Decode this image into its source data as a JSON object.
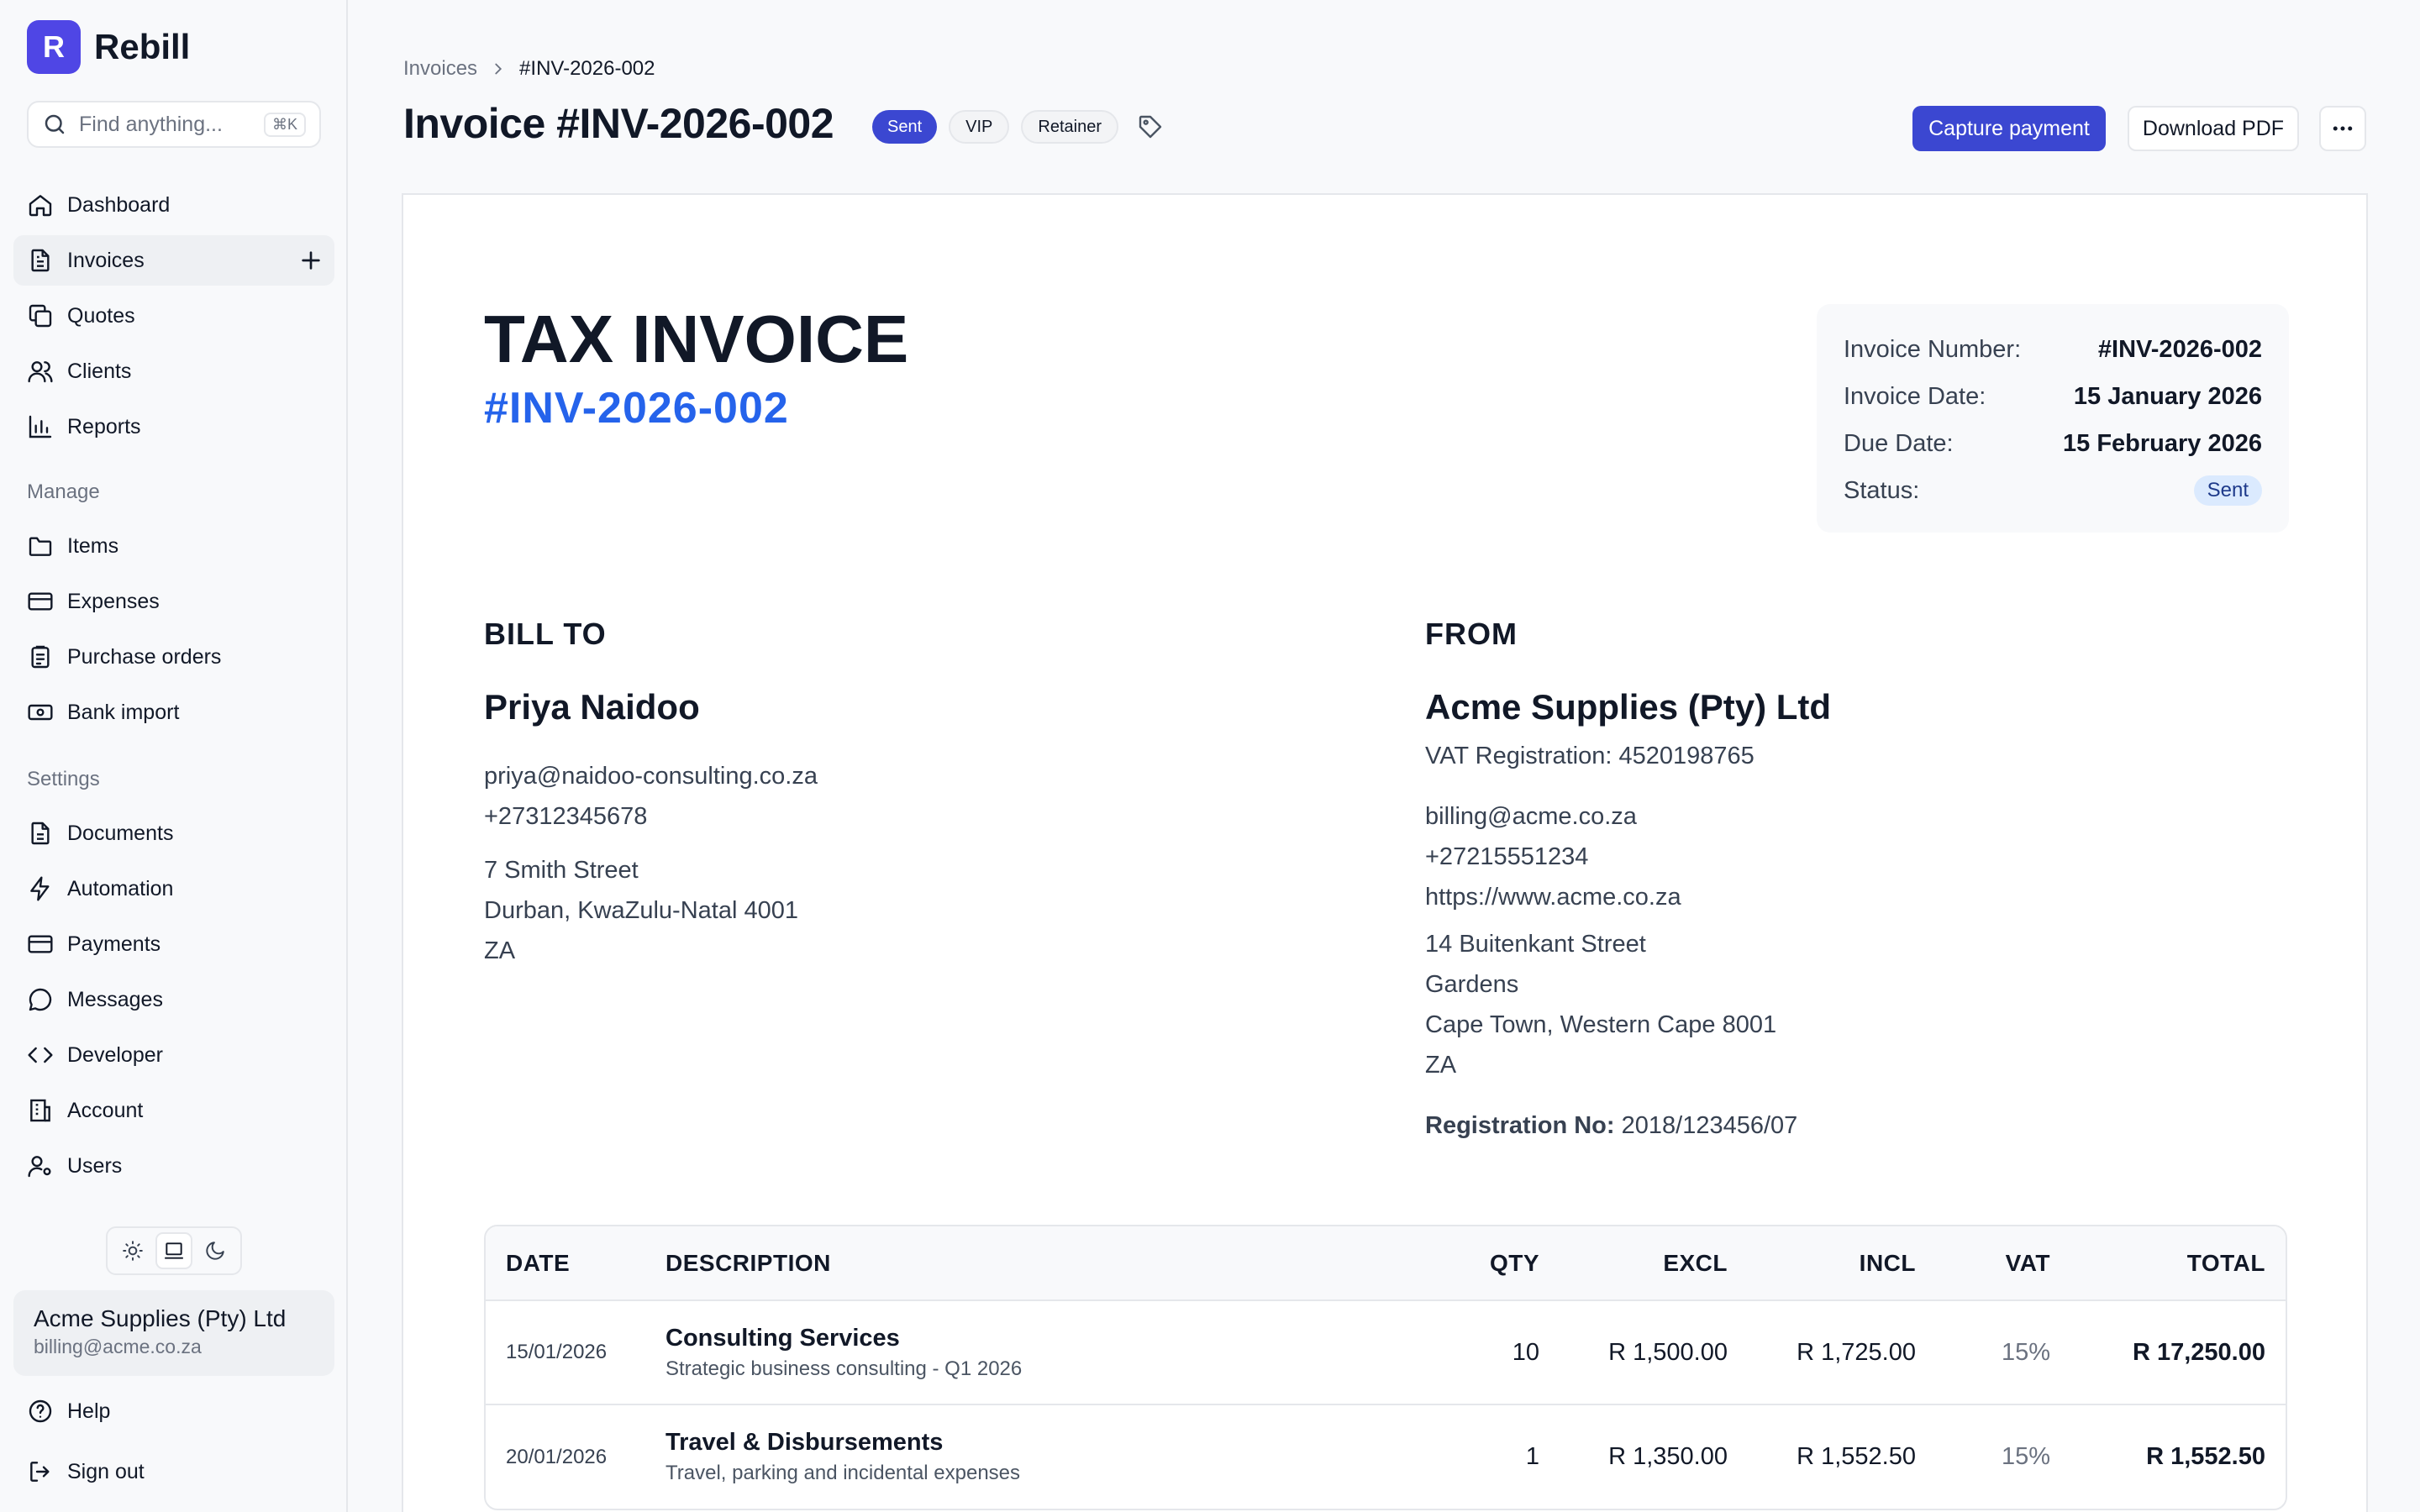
{
  "app": {
    "name": "Rebill",
    "logo_letter": "R"
  },
  "search": {
    "placeholder": "Find anything...",
    "shortcut": "⌘K"
  },
  "sidebar": {
    "primary": [
      {
        "label": "Dashboard",
        "icon": "home-icon"
      },
      {
        "label": "Invoices",
        "icon": "document-icon",
        "active": true
      },
      {
        "label": "Quotes",
        "icon": "copy-icon"
      },
      {
        "label": "Clients",
        "icon": "users-icon"
      },
      {
        "label": "Reports",
        "icon": "bar-chart-icon"
      }
    ],
    "manage_label": "Manage",
    "manage": [
      {
        "label": "Items",
        "icon": "folder-icon"
      },
      {
        "label": "Expenses",
        "icon": "credit-card-icon"
      },
      {
        "label": "Purchase orders",
        "icon": "clipboard-icon"
      },
      {
        "label": "Bank import",
        "icon": "banknote-icon"
      }
    ],
    "settings_label": "Settings",
    "settings": [
      {
        "label": "Documents",
        "icon": "document-icon"
      },
      {
        "label": "Automation",
        "icon": "bolt-icon"
      },
      {
        "label": "Payments",
        "icon": "credit-card-icon"
      },
      {
        "label": "Messages",
        "icon": "message-icon"
      },
      {
        "label": "Developer",
        "icon": "code-icon"
      },
      {
        "label": "Account",
        "icon": "building-icon"
      },
      {
        "label": "Users",
        "icon": "user-cog-icon"
      }
    ],
    "org": {
      "name": "Acme Supplies (Pty) Ltd",
      "email": "billing@acme.co.za"
    },
    "footer": [
      {
        "label": "Help",
        "icon": "help-circle-icon"
      },
      {
        "label": "Sign out",
        "icon": "sign-out-icon"
      }
    ]
  },
  "header": {
    "breadcrumb": [
      "Invoices",
      "#INV-2026-002"
    ],
    "title": "Invoice #INV-2026-002",
    "status_badge": "Sent",
    "tags": [
      "VIP",
      "Retainer"
    ],
    "capture_payment": "Capture payment",
    "download_pdf": "Download PDF"
  },
  "invoice": {
    "heading": "TAX INVOICE",
    "number": "#INV-2026-002",
    "meta": [
      {
        "key": "Invoice Number:",
        "value": "#INV-2026-002"
      },
      {
        "key": "Invoice Date:",
        "value": "15 January 2026"
      },
      {
        "key": "Due Date:",
        "value": "15 February 2026"
      },
      {
        "key": "Status:",
        "value": "Sent"
      }
    ],
    "bill_to": {
      "heading": "BILL TO",
      "name": "Priya Naidoo",
      "email": "priya@naidoo-consulting.co.za",
      "phone": "+27312345678",
      "address": [
        "7 Smith Street",
        "Durban, KwaZulu-Natal 4001",
        "ZA"
      ]
    },
    "from": {
      "heading": "FROM",
      "name": "Acme Supplies (Pty) Ltd",
      "vat": "VAT Registration: 4520198765",
      "email": "billing@acme.co.za",
      "phone": "+27215551234",
      "website": "https://www.acme.co.za",
      "address": [
        "14 Buitenkant Street",
        "Gardens",
        "Cape Town, Western Cape 8001",
        "ZA"
      ],
      "registration_label": "Registration No:",
      "registration_value": "2018/123456/07"
    },
    "columns": [
      "DATE",
      "DESCRIPTION",
      "QTY",
      "EXCL",
      "INCL",
      "VAT",
      "TOTAL"
    ],
    "items": [
      {
        "date": "15/01/2026",
        "title": "Consulting Services",
        "sub": "Strategic business consulting - Q1 2026",
        "qty": "10",
        "excl": "R 1,500.00",
        "incl": "R 1,725.00",
        "vat": "15%",
        "total": "R 17,250.00"
      },
      {
        "date": "20/01/2026",
        "title": "Travel & Disbursements",
        "sub": "Travel, parking and incidental expenses",
        "qty": "1",
        "excl": "R 1,350.00",
        "incl": "R 1,552.50",
        "vat": "15%",
        "total": "R 1,552.50"
      }
    ]
  }
}
